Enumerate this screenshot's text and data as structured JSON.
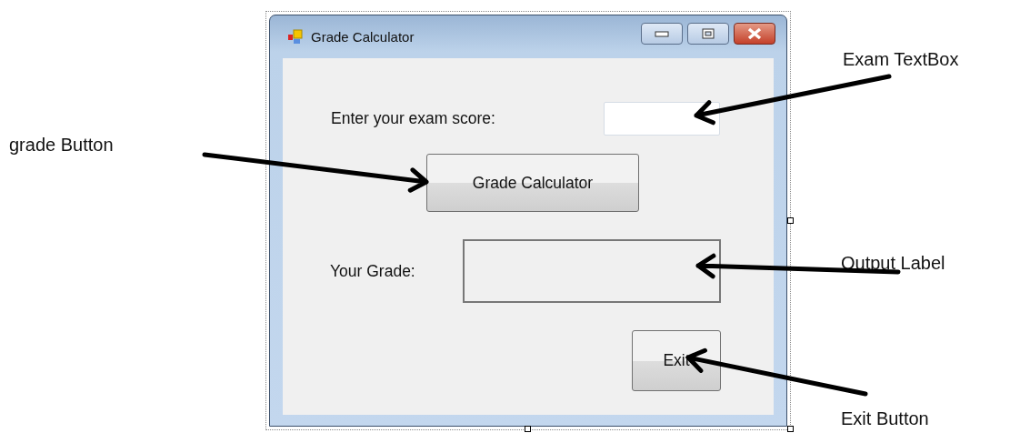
{
  "window": {
    "title": "Grade Calculator"
  },
  "form": {
    "score_label": "Enter your exam score:",
    "calculate_button": "Grade Calculator",
    "grade_label": "Your Grade:",
    "exit_button": "Exit"
  },
  "annotations": [
    {
      "text": "Exam TextBox"
    },
    {
      "text": "grade Button"
    },
    {
      "text": "Output Label"
    },
    {
      "text": "Exit Button"
    }
  ]
}
